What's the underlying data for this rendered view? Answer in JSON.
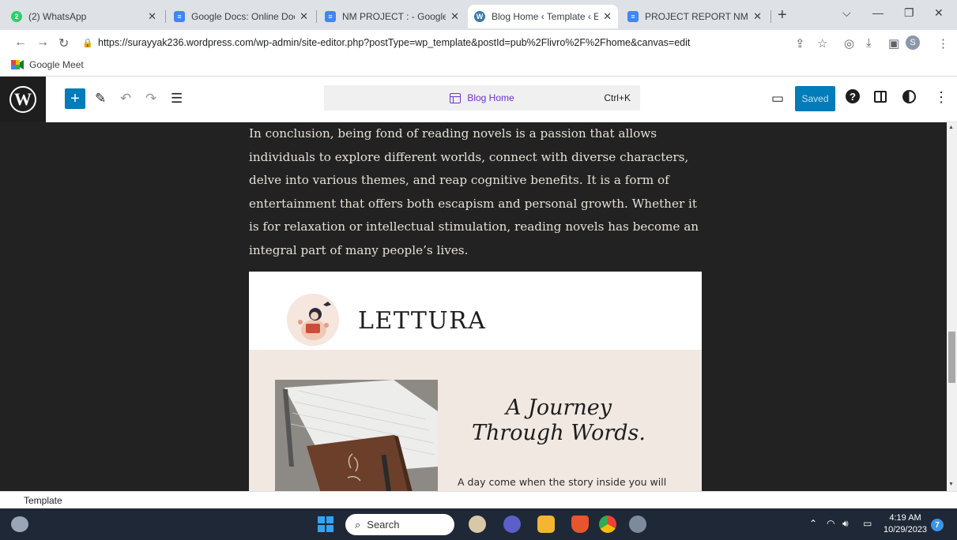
{
  "browser": {
    "tabs": [
      {
        "label": "(2) WhatsApp",
        "icon": "whatsapp-icon",
        "active": false
      },
      {
        "label": "Google Docs: Online Docum",
        "icon": "google-docs-icon",
        "active": false
      },
      {
        "label": "NM PROJECT : - Google Doc",
        "icon": "google-docs-icon",
        "active": false
      },
      {
        "label": "Blog Home ‹ Template ‹ Edit",
        "icon": "wordpress-icon",
        "active": true
      },
      {
        "label": "PROJECT REPORT NM - Goo",
        "icon": "google-docs-icon",
        "active": false
      }
    ],
    "whatsapp_badge": "2",
    "profile_initial": "S",
    "url": "https://surayyak236.wordpress.com/wp-admin/site-editor.php?postType=wp_template&postId=pub%2Flivro%2F%2Fhome&canvas=edit",
    "bookmarks": [
      {
        "label": "Google Meet",
        "icon": "google-meet-icon"
      }
    ]
  },
  "editor": {
    "command_title": "Blog Home",
    "command_shortcut": "Ctrl+K",
    "save_label": "Saved",
    "help_glyph": "?",
    "logo_glyph": "W",
    "inserter_glyph": "+",
    "colors": {
      "accent": "#007cba",
      "command_text": "#6d33c9",
      "canvas_bg": "#222222"
    }
  },
  "content": {
    "paragraph": "In conclusion, being fond of reading novels is a passion that allows individuals to explore different worlds, connect with diverse characters, delve into various themes, and reap cognitive benefits. It is a form of entertainment that offers both escapism and personal growth. Whether it is for relaxation or intellectual stimulation, reading novels has become an integral part of many people’s lives.",
    "card": {
      "brand": "LETTURA",
      "headline_line1": "A Journey",
      "headline_line2": "Through Words.",
      "tagline": "A day come when the story inside you will"
    }
  },
  "footer": {
    "breadcrumb": "Template"
  },
  "taskbar": {
    "search_placeholder": "Search",
    "time": "4:19 AM",
    "date": "10/29/2023",
    "notification_count": "7"
  }
}
